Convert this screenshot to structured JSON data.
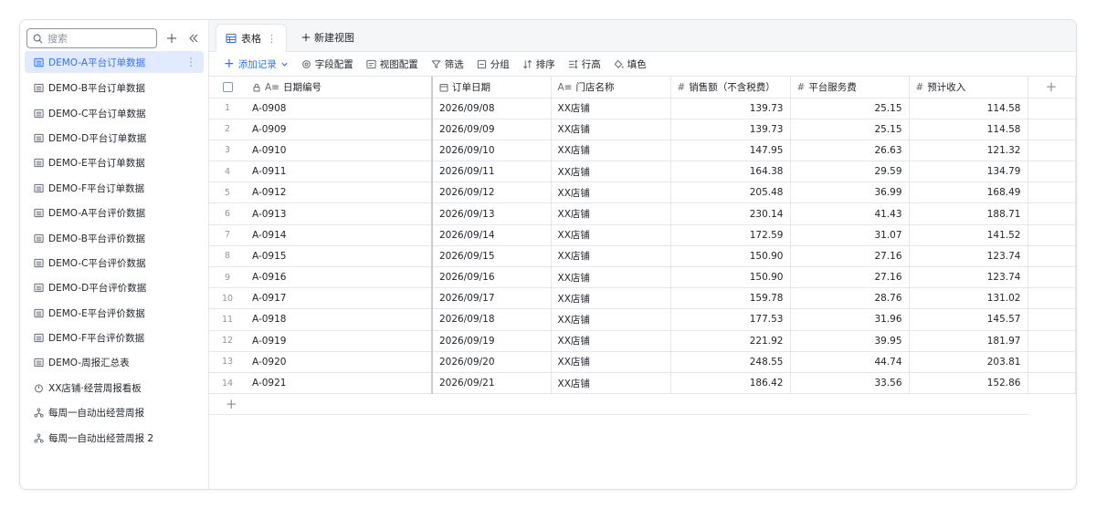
{
  "sidebar": {
    "search_placeholder": "搜索",
    "add_icon": "plus-icon",
    "collapse_icon": "double-chevron-left-icon",
    "items": [
      {
        "label": "DEMO-A平台订单数据",
        "icon": "table-icon",
        "active": true
      },
      {
        "label": "DEMO-B平台订单数据",
        "icon": "table-icon"
      },
      {
        "label": "DEMO-C平台订单数据",
        "icon": "table-icon"
      },
      {
        "label": "DEMO-D平台订单数据",
        "icon": "table-icon"
      },
      {
        "label": "DEMO-E平台订单数据",
        "icon": "table-icon"
      },
      {
        "label": "DEMO-F平台订单数据",
        "icon": "table-icon"
      },
      {
        "label": "DEMO-A平台评价数据",
        "icon": "table-icon"
      },
      {
        "label": "DEMO-B平台评价数据",
        "icon": "table-icon"
      },
      {
        "label": "DEMO-C平台评价数据",
        "icon": "table-icon"
      },
      {
        "label": "DEMO-D平台评价数据",
        "icon": "table-icon"
      },
      {
        "label": "DEMO-E平台评价数据",
        "icon": "table-icon"
      },
      {
        "label": "DEMO-F平台评价数据",
        "icon": "table-icon"
      },
      {
        "label": "DEMO-周报汇总表",
        "icon": "table-icon"
      },
      {
        "label": "XX店铺·经营周报看板",
        "icon": "dashboard-icon"
      },
      {
        "label": "每周一自动出经营周报",
        "icon": "workflow-icon"
      },
      {
        "label": "每周一自动出经营周报 2",
        "icon": "workflow-icon"
      }
    ]
  },
  "tabs": {
    "active_label": "表格",
    "new_view_label": "新建视图"
  },
  "toolbar": {
    "add_record": "添加记录",
    "field_config": "字段配置",
    "view_config": "视图配置",
    "filter": "筛选",
    "group": "分组",
    "sort": "排序",
    "row_height": "行高",
    "fill_color": "填色"
  },
  "table": {
    "columns": [
      "日期编号",
      "订单日期",
      "门店名称",
      "销售额（不含税费）",
      "平台服务费",
      "预计收入"
    ],
    "rows": [
      {
        "idx": "1",
        "id": "A-0908",
        "date": "2026/09/08",
        "store": "XX店铺",
        "sales": "139.73",
        "fee": "25.15",
        "income": "114.58"
      },
      {
        "idx": "2",
        "id": "A-0909",
        "date": "2026/09/09",
        "store": "XX店铺",
        "sales": "139.73",
        "fee": "25.15",
        "income": "114.58"
      },
      {
        "idx": "3",
        "id": "A-0910",
        "date": "2026/09/10",
        "store": "XX店铺",
        "sales": "147.95",
        "fee": "26.63",
        "income": "121.32"
      },
      {
        "idx": "4",
        "id": "A-0911",
        "date": "2026/09/11",
        "store": "XX店铺",
        "sales": "164.38",
        "fee": "29.59",
        "income": "134.79"
      },
      {
        "idx": "5",
        "id": "A-0912",
        "date": "2026/09/12",
        "store": "XX店铺",
        "sales": "205.48",
        "fee": "36.99",
        "income": "168.49"
      },
      {
        "idx": "6",
        "id": "A-0913",
        "date": "2026/09/13",
        "store": "XX店铺",
        "sales": "230.14",
        "fee": "41.43",
        "income": "188.71"
      },
      {
        "idx": "7",
        "id": "A-0914",
        "date": "2026/09/14",
        "store": "XX店铺",
        "sales": "172.59",
        "fee": "31.07",
        "income": "141.52"
      },
      {
        "idx": "8",
        "id": "A-0915",
        "date": "2026/09/15",
        "store": "XX店铺",
        "sales": "150.90",
        "fee": "27.16",
        "income": "123.74"
      },
      {
        "idx": "9",
        "id": "A-0916",
        "date": "2026/09/16",
        "store": "XX店铺",
        "sales": "150.90",
        "fee": "27.16",
        "income": "123.74"
      },
      {
        "idx": "10",
        "id": "A-0917",
        "date": "2026/09/17",
        "store": "XX店铺",
        "sales": "159.78",
        "fee": "28.76",
        "income": "131.02"
      },
      {
        "idx": "11",
        "id": "A-0918",
        "date": "2026/09/18",
        "store": "XX店铺",
        "sales": "177.53",
        "fee": "31.96",
        "income": "145.57"
      },
      {
        "idx": "12",
        "id": "A-0919",
        "date": "2026/09/19",
        "store": "XX店铺",
        "sales": "221.92",
        "fee": "39.95",
        "income": "181.97"
      },
      {
        "idx": "13",
        "id": "A-0920",
        "date": "2026/09/20",
        "store": "XX店铺",
        "sales": "248.55",
        "fee": "44.74",
        "income": "203.81"
      },
      {
        "idx": "14",
        "id": "A-0921",
        "date": "2026/09/21",
        "store": "XX店铺",
        "sales": "186.42",
        "fee": "33.56",
        "income": "152.86"
      }
    ]
  }
}
